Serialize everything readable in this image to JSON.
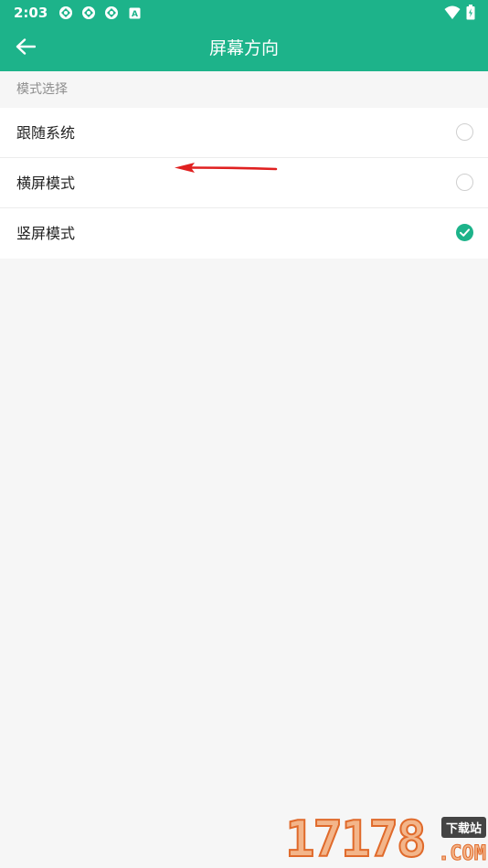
{
  "status_bar": {
    "time": "2:03",
    "badge_letter": "A"
  },
  "app_bar": {
    "title": "屏幕方向"
  },
  "section": {
    "header": "模式选择"
  },
  "options": [
    {
      "label": "跟随系统",
      "selected": false
    },
    {
      "label": "横屏模式",
      "selected": false
    },
    {
      "label": "竖屏模式",
      "selected": true
    }
  ],
  "colors": {
    "primary": "#1db38a",
    "background": "#f6f6f6",
    "annotation_arrow": "#e02020"
  },
  "watermark": {
    "digits": "17178",
    "tag": "下载站",
    "suffix": ".COM"
  }
}
